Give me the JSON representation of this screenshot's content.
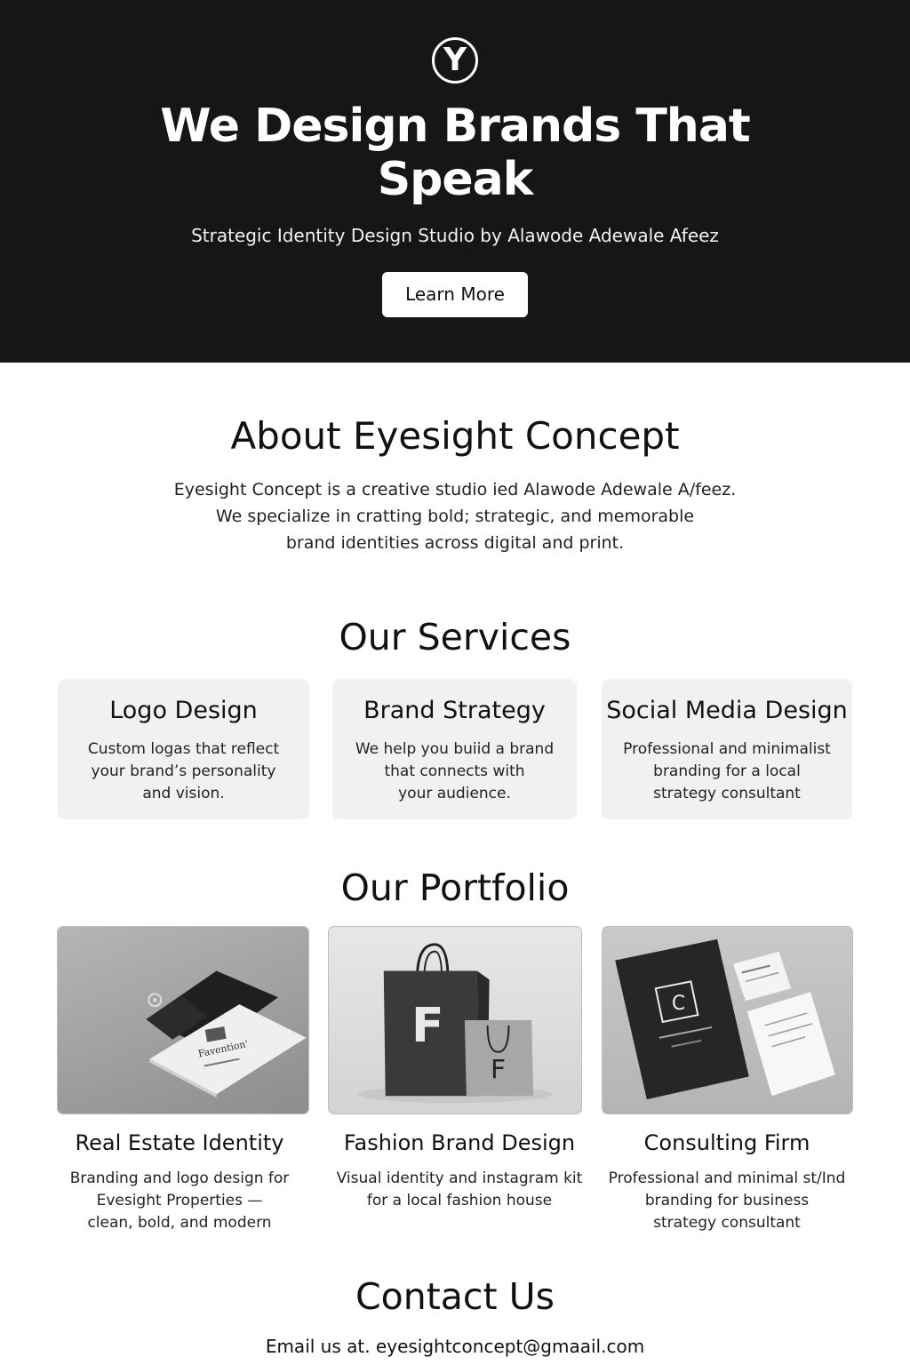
{
  "hero": {
    "logo_letter": "Y",
    "title_line1": "We Design Brands That",
    "title_line2": "Speak",
    "subtitle": "Strategic Identity Design Studio by Alawode Adewale Afeez",
    "button_label": "Learn More",
    "background_color": "#161616"
  },
  "about": {
    "title": "About Eyesight Concept",
    "lines": [
      "Eyesight Concept is a creative studio ied Alawode Adewale A/feez.",
      "We specialize in cratting bold; strategic, and memorable",
      "brand identities across digital and print."
    ]
  },
  "services": {
    "title": "Our Services",
    "items": [
      {
        "title": "Logo Design",
        "lines": [
          "Custom logas that reflect",
          "your brand’s personality",
          "and vision."
        ]
      },
      {
        "title": "Brand Strategy",
        "lines": [
          "We help you buiid a brand",
          "that connects with",
          "your audience."
        ]
      },
      {
        "title": "Social Media Design",
        "lines": [
          "Professional and minimalist",
          "branding for a local",
          "strategy consultant"
        ]
      }
    ],
    "card_color": "#f1f1f1"
  },
  "portfolio": {
    "title": "Our Portfolio",
    "items": [
      {
        "title": "Real Estate Identity",
        "lines": [
          "Branding and logo design for",
          "Evesight Properties —",
          "clean, bold, and modern"
        ],
        "image_card_text": "Favention'"
      },
      {
        "title": "Fashion Brand Design",
        "lines": [
          "Visual identity and instagram kit",
          "for a local fashion house"
        ],
        "bag_letter_large": "F",
        "bag_letter_small": "F"
      },
      {
        "title": "Consulting Firm",
        "lines": [
          "Professional and minimal st/Ind",
          "branding for business",
          "strategy consultant"
        ],
        "folder_letter": "C"
      }
    ]
  },
  "contact": {
    "title": "Contact Us",
    "email_line": "Email us at. eyesightconcept@gmaail.com"
  }
}
